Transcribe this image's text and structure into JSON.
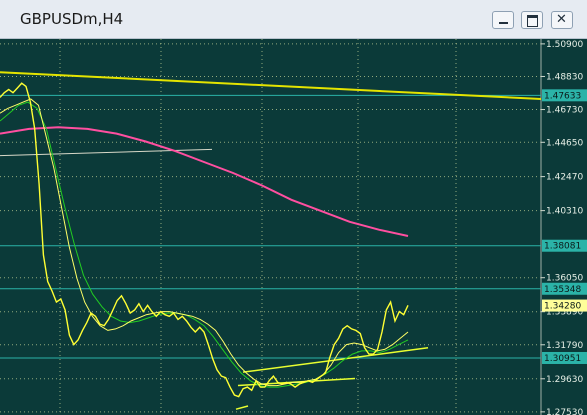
{
  "window": {
    "title": "GBPUSDm,H4"
  },
  "colors": {
    "background": "#0b3a39",
    "grid": "#c9d89a",
    "price_line": "#ffff33",
    "ma_fast": "#ffff66",
    "ma_slow": "#22cc22",
    "ma_long": "#ff4fa0",
    "hline": "#2bb3a8",
    "trend_top": "#e4e400"
  },
  "chart_data": {
    "type": "line",
    "symbol": "GBPUSDm",
    "timeframe": "H4",
    "y_ticks": [
      "1.50900",
      "1.48830",
      "1.46730",
      "1.44650",
      "1.42470",
      "1.40310",
      "1.36050",
      "1.33890",
      "1.31790",
      "1.29630",
      "1.27530"
    ],
    "ylim": [
      1.2733,
      1.5121
    ],
    "horizontal_levels": [
      {
        "value": 1.47633,
        "label": "1.47633",
        "color": "#2bb3a8"
      },
      {
        "value": 1.38081,
        "label": "1.38081",
        "color": "#2bb3a8"
      },
      {
        "value": 1.35348,
        "label": "1.35348",
        "color": "#2bb3a8"
      },
      {
        "value": 1.3428,
        "label": "1.34280",
        "color": "#ffff99",
        "current": true
      },
      {
        "value": 1.30951,
        "label": "1.30951",
        "color": "#2bb3a8"
      }
    ],
    "price": [
      1.475,
      1.478,
      1.48,
      1.478,
      1.481,
      1.484,
      1.482,
      1.472,
      1.455,
      1.42,
      1.375,
      1.358,
      1.352,
      1.345,
      1.347,
      1.34,
      1.324,
      1.318,
      1.321,
      1.327,
      1.332,
      1.338,
      1.336,
      1.331,
      1.33,
      1.334,
      1.34,
      1.346,
      1.349,
      1.344,
      1.338,
      1.34,
      1.344,
      1.339,
      1.343,
      1.339,
      1.336,
      1.339,
      1.337,
      1.336,
      1.338,
      1.334,
      1.336,
      1.333,
      1.329,
      1.326,
      1.329,
      1.326,
      1.318,
      1.309,
      1.302,
      1.298,
      1.297,
      1.291,
      1.286,
      1.285,
      1.29,
      1.291,
      1.289,
      1.295,
      1.291,
      1.291,
      1.295,
      1.298,
      1.294,
      1.293,
      1.294,
      1.293,
      1.291,
      1.293,
      1.294,
      1.295,
      1.294,
      1.296,
      1.298,
      1.3,
      1.31,
      1.318,
      1.322,
      1.328,
      1.33,
      1.328,
      1.327,
      1.325,
      1.316,
      1.312,
      1.312,
      1.315,
      1.326,
      1.34,
      1.345,
      1.333,
      1.339,
      1.337,
      1.343
    ],
    "ma_fast": [
      1.465,
      1.468,
      1.47,
      1.472,
      1.474,
      1.47,
      1.45,
      1.43,
      1.405,
      1.38,
      1.36,
      1.345,
      1.336,
      1.33,
      1.327,
      1.328,
      1.33,
      1.333,
      1.335,
      1.337,
      1.338,
      1.339,
      1.339,
      1.338,
      1.337,
      1.336,
      1.334,
      1.331,
      1.327,
      1.32,
      1.312,
      1.305,
      1.3,
      1.296,
      1.293,
      1.292,
      1.292,
      1.293,
      1.294,
      1.294,
      1.295,
      1.296,
      1.299,
      1.305,
      1.313,
      1.318,
      1.319,
      1.318,
      1.316,
      1.314,
      1.315,
      1.318,
      1.322,
      1.326
    ],
    "ma_slow": [
      1.46,
      1.465,
      1.47,
      1.472,
      1.468,
      1.455,
      1.43,
      1.405,
      1.382,
      1.362,
      1.35,
      1.342,
      1.336,
      1.333,
      1.332,
      1.333,
      1.335,
      1.337,
      1.338,
      1.338,
      1.337,
      1.334,
      1.33,
      1.323,
      1.315,
      1.307,
      1.3,
      1.295,
      1.292,
      1.291,
      1.291,
      1.292,
      1.293,
      1.294,
      1.296,
      1.299,
      1.303,
      1.308,
      1.312,
      1.314,
      1.314,
      1.313,
      1.315,
      1.318,
      1.321
    ],
    "ma_long": [
      1.452,
      1.455,
      1.456,
      1.455,
      1.452,
      1.447,
      1.441,
      1.434,
      1.427,
      1.419,
      1.41,
      1.403,
      1.396,
      1.391,
      1.387
    ],
    "trendline_top": [
      1.491,
      1.474
    ],
    "trendline_grey": [
      1.438,
      1.442
    ]
  }
}
